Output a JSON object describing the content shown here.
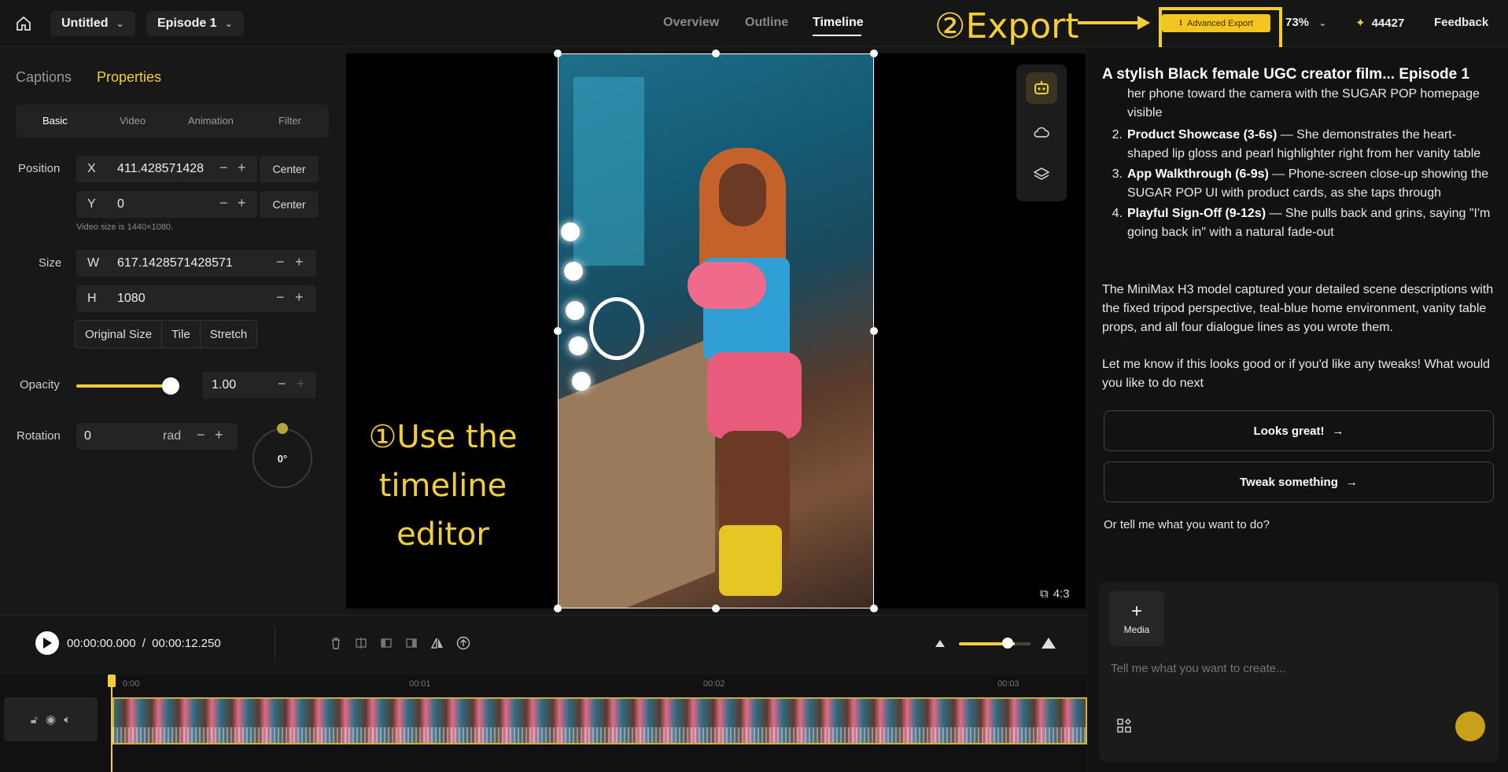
{
  "header": {
    "project": "Untitled",
    "episode": "Episode 1",
    "tabs": [
      "Overview",
      "Outline",
      "Timeline"
    ],
    "active_tab": "Timeline",
    "advanced_export": "Advanced Export",
    "zoom": "73%",
    "credits": "44427",
    "feedback": "Feedback"
  },
  "annotations": {
    "export": "②Export",
    "timeline": "①Use the timeline editor"
  },
  "left_panel": {
    "tabs": [
      "Captions",
      "Properties"
    ],
    "active_tab": "Properties",
    "subtabs": [
      "Basic",
      "Video",
      "Animation",
      "Filter"
    ],
    "active_subtab": "Basic",
    "position_label": "Position",
    "x_axis": "X",
    "x_value": "411.428571428",
    "y_axis": "Y",
    "y_value": "0",
    "center_label": "Center",
    "video_size_hint": "Video size is 1440×1080.",
    "size_label": "Size",
    "w_axis": "W",
    "w_value": "617.1428571428571",
    "h_axis": "H",
    "h_value": "1080",
    "fit_options": [
      "Original Size",
      "Tile",
      "Stretch"
    ],
    "opacity_label": "Opacity",
    "opacity_value": "1.00",
    "opacity_level": 1.0,
    "rotation_label": "Rotation",
    "rotation_value": "0",
    "rotation_unit": "rad",
    "rotation_dial": "0°"
  },
  "canvas": {
    "aspect_ratio": "4:3",
    "tools": [
      "robot-icon",
      "cloud-icon",
      "layers-icon"
    ]
  },
  "playback": {
    "current_time": "00:00:00.000",
    "total_time": "00:00:12.250",
    "separator": "/"
  },
  "timeline": {
    "ruler_marks": [
      "0:00",
      "00:01",
      "00:02",
      "00:03"
    ]
  },
  "chat": {
    "title": "A stylish Black female UGC creator film... Episode 1",
    "partial_item": "her phone toward the camera with the SUGAR POP homepage visible",
    "list": [
      {
        "n": "2.",
        "bold": "Product Showcase (3-6s)",
        "text": " — She demonstrates the heart-shaped lip gloss and pearl highlighter right from her vanity table"
      },
      {
        "n": "3.",
        "bold": "App Walkthrough (6-9s)",
        "text": " — Phone-screen close-up showing the SUGAR POP UI with product cards, as she taps through"
      },
      {
        "n": "4.",
        "bold": "Playful Sign-Off (9-12s)",
        "text": " — She pulls back and grins, saying \"I'm going back in\" with a natural fade-out"
      }
    ],
    "paragraph1": "The MiniMax H3 model captured your detailed scene descriptions with the fixed tripod perspective, teal-blue home environment, vanity table props, and all four dialogue lines as you wrote them.",
    "paragraph2": "Let me know if this looks good or if you'd like any tweaks! What would you like to do next",
    "option1": "Looks great!",
    "option2": "Tweak something",
    "or_tell": "Or tell me what you want to do?",
    "media_label": "Media",
    "input_placeholder": "Tell me what you want to create..."
  },
  "colors": {
    "accent": "#f2cf3a",
    "background": "#161616"
  }
}
